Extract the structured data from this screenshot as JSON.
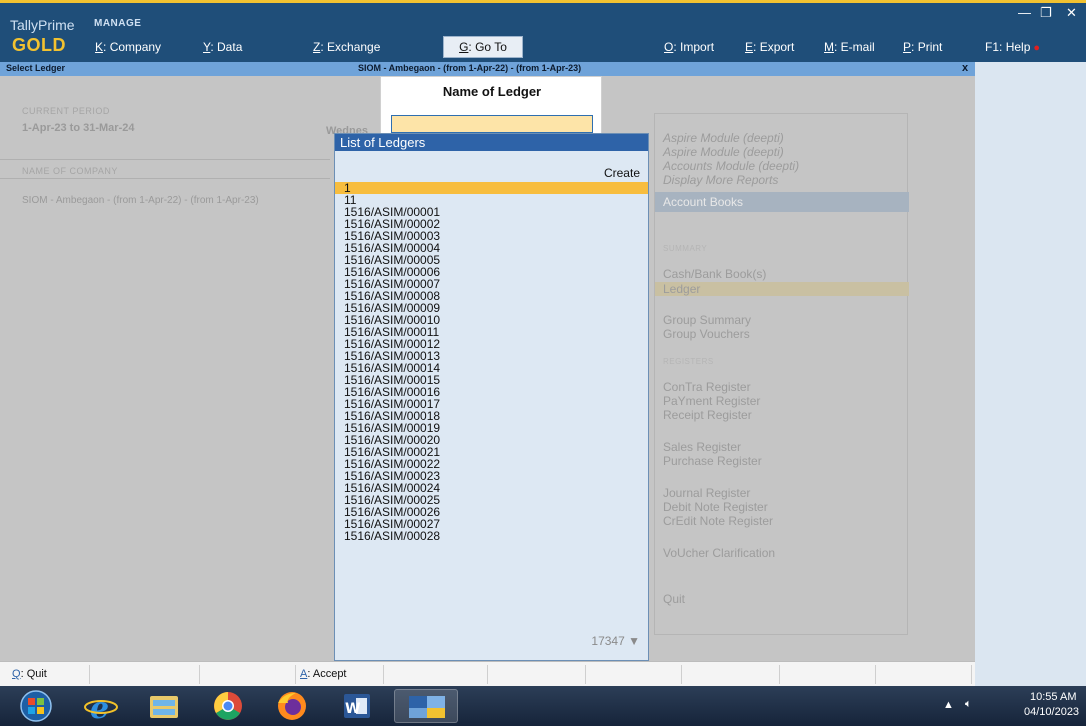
{
  "app": {
    "brand_name": "TallyPrime",
    "brand_mode": "MANAGE",
    "edition": "GOLD"
  },
  "menu": [
    {
      "key": "K",
      "label": "Company"
    },
    {
      "key": "Y",
      "label": "Data"
    },
    {
      "key": "Z",
      "label": "Exchange"
    },
    {
      "key": "G",
      "label": "Go To"
    },
    {
      "key": "O",
      "label": "Import"
    },
    {
      "key": "E",
      "label": "Export"
    },
    {
      "key": "M",
      "label": "E-mail"
    },
    {
      "key": "P",
      "label": "Print"
    },
    {
      "key": "F1",
      "label": "Help"
    }
  ],
  "header": {
    "screen_title": "Select Ledger",
    "company_context": "SIOM - Ambegaon -  (from 1-Apr-22) - (from 1-Apr-23)",
    "close": "x"
  },
  "background": {
    "current_period_label": "CURRENT PERIOD",
    "current_period": "1-Apr-23 to 31-Mar-24",
    "date_partial": "Wednes",
    "name_of_company_label": "NAME OF COMPANY",
    "company_name": "SIOM - Ambegaon -  (from 1-Apr-22) - (from 1-Apr-23)"
  },
  "gateway": {
    "top_items": [
      "Aspire Module (deepti)",
      "Aspire Module (deepti)",
      "Accounts Module (deepti)",
      "Display More Reports"
    ],
    "heading": "Account Books",
    "summary_label": "SUMMARY",
    "registers_label": "REGISTERS",
    "items": [
      "Cash/Bank Book(s)",
      "Ledger",
      "Group Summary",
      "Group Vouchers",
      "ConTra Register",
      "PaYment Register",
      "Receipt Register",
      "Sales Register",
      "Purchase Register",
      "Journal Register",
      "Debit Note Register",
      "CrEdit Note Register",
      "VoUcher Clarification",
      "Quit"
    ]
  },
  "name_box": {
    "title": "Name of Ledger",
    "value": ""
  },
  "ledger_list": {
    "title": "List of Ledgers",
    "create_label": "Create",
    "items": [
      "1",
      "11",
      "1516/ASIM/00001",
      "1516/ASIM/00002",
      "1516/ASIM/00003",
      "1516/ASIM/00004",
      "1516/ASIM/00005",
      "1516/ASIM/00006",
      "1516/ASIM/00007",
      "1516/ASIM/00008",
      "1516/ASIM/00009",
      "1516/ASIM/00010",
      "1516/ASIM/00011",
      "1516/ASIM/00012",
      "1516/ASIM/00013",
      "1516/ASIM/00014",
      "1516/ASIM/00015",
      "1516/ASIM/00016",
      "1516/ASIM/00017",
      "1516/ASIM/00018",
      "1516/ASIM/00019",
      "1516/ASIM/00020",
      "1516/ASIM/00021",
      "1516/ASIM/00022",
      "1516/ASIM/00023",
      "1516/ASIM/00024",
      "1516/ASIM/00025",
      "1516/ASIM/00026",
      "1516/ASIM/00027",
      "1516/ASIM/00028"
    ],
    "selected_index": 0,
    "count": "17347",
    "scroll_indicator": "▼"
  },
  "buttons": {
    "quit_key": "Q",
    "quit_label": "Quit",
    "accept_key": "A",
    "accept_label": "Accept"
  },
  "taskbar": {
    "apps": [
      "windows-start",
      "internet-explorer",
      "file-explorer",
      "chrome",
      "firefox",
      "word",
      "tally"
    ],
    "time": "10:55 AM",
    "date": "04/10/2023"
  },
  "colors": {
    "title_bar": "#1f4e79",
    "accent_gold": "#f2c230",
    "list_header": "#2e63a8",
    "selection": "#f7bd3e",
    "input_fill": "#fde4a8"
  }
}
